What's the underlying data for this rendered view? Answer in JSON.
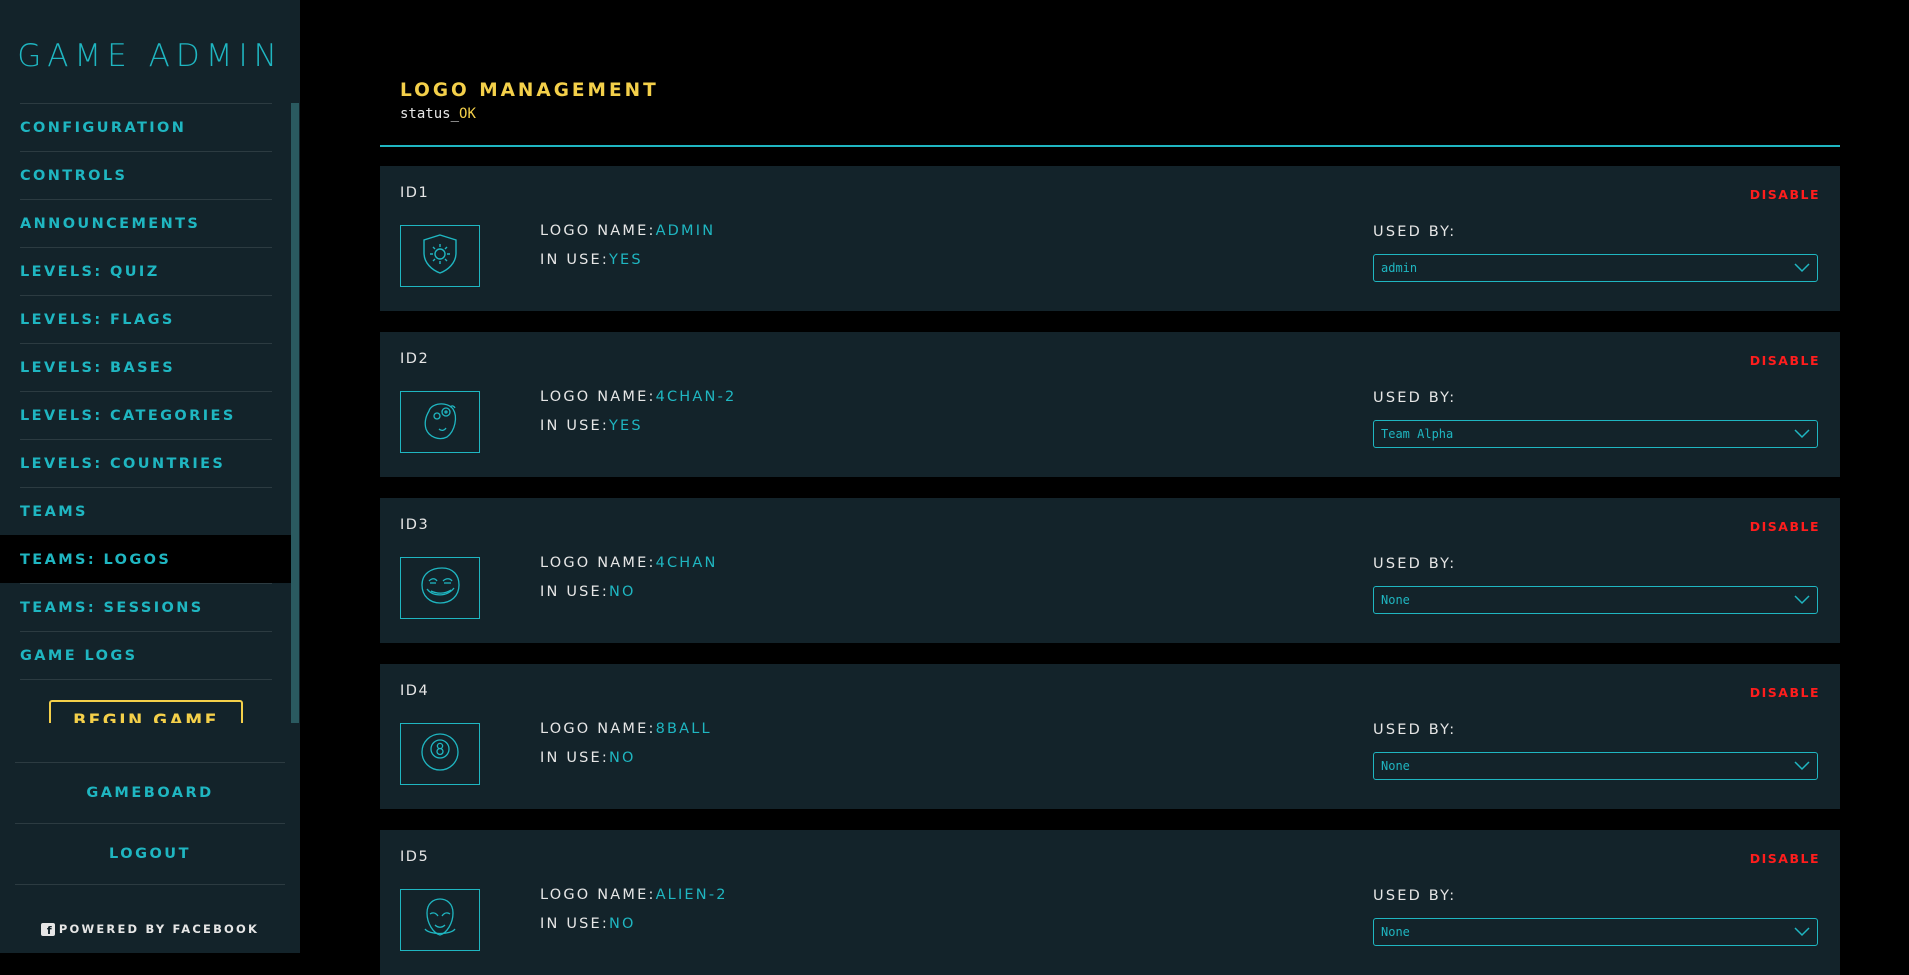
{
  "app": {
    "brand": "GAME ADMIN"
  },
  "sidebar": {
    "items": [
      {
        "label": "CONFIGURATION"
      },
      {
        "label": "CONTROLS"
      },
      {
        "label": "ANNOUNCEMENTS"
      },
      {
        "label": "LEVELS: QUIZ"
      },
      {
        "label": "LEVELS: FLAGS"
      },
      {
        "label": "LEVELS: BASES"
      },
      {
        "label": "LEVELS: CATEGORIES"
      },
      {
        "label": "LEVELS: COUNTRIES"
      },
      {
        "label": "TEAMS"
      },
      {
        "label": "TEAMS: LOGOS",
        "active": true
      },
      {
        "label": "TEAMS: SESSIONS"
      },
      {
        "label": "GAME LOGS"
      }
    ],
    "begin_game": "BEGIN GAME",
    "gameboard": "GAMEBOARD",
    "logout": "LOGOUT",
    "powered_by": "POWERED BY FACEBOOK",
    "fb_icon": "f"
  },
  "page": {
    "title": "LOGO MANAGEMENT",
    "status_prefix": "status_",
    "status_value": "OK"
  },
  "labels": {
    "logo_name": "LOGO NAME:",
    "in_use": "IN USE:",
    "used_by": "USED BY:",
    "disable": "DISABLE"
  },
  "logos": [
    {
      "id": "ID1",
      "name": "ADMIN",
      "in_use": "YES",
      "used_by": "admin",
      "icon": "shield-gear-icon"
    },
    {
      "id": "ID2",
      "name": "4CHAN-2",
      "in_use": "YES",
      "used_by": "Team Alpha",
      "icon": "rage-face-icon"
    },
    {
      "id": "ID3",
      "name": "4CHAN",
      "in_use": "NO",
      "used_by": "None",
      "icon": "troll-face-icon"
    },
    {
      "id": "ID4",
      "name": "8BALL",
      "in_use": "NO",
      "used_by": "None",
      "icon": "eight-ball-icon"
    },
    {
      "id": "ID5",
      "name": "ALIEN-2",
      "in_use": "NO",
      "used_by": "None",
      "icon": "alien-face-icon"
    }
  ],
  "colors": {
    "accent": "#1fb6c1",
    "highlight": "#f4d04a",
    "danger": "#ff1d1d",
    "panel": "#13232a",
    "background": "#000000"
  }
}
